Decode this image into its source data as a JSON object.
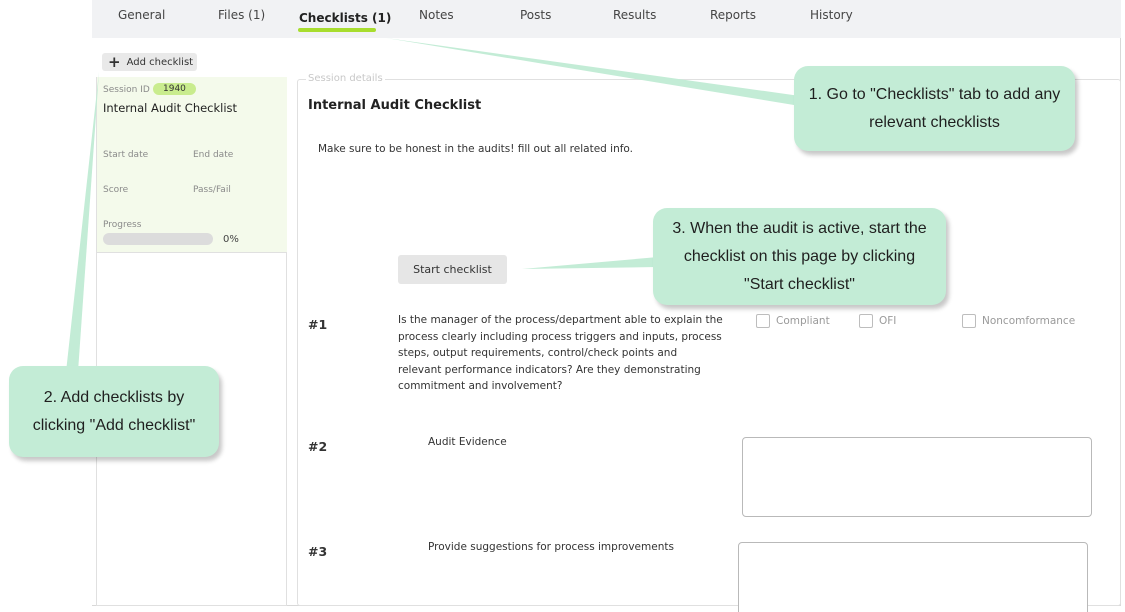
{
  "tabs": [
    {
      "label": "General"
    },
    {
      "label": "Files (1)"
    },
    {
      "label": "Checklists (1)",
      "active": true
    },
    {
      "label": "Notes"
    },
    {
      "label": "Posts"
    },
    {
      "label": "Results"
    },
    {
      "label": "Reports"
    },
    {
      "label": "History"
    }
  ],
  "toolbar": {
    "add_checklist_label": "Add checklist"
  },
  "session": {
    "id_label": "Session ID",
    "id_value": "1940",
    "name": "Internal Audit Checklist",
    "start_date_label": "Start date",
    "end_date_label": "End date",
    "score_label": "Score",
    "pass_fail_label": "Pass/Fail",
    "progress_label": "Progress",
    "progress_value": 0,
    "progress_text": "0%"
  },
  "details": {
    "legend": "Session details",
    "title": "Internal Audit Checklist",
    "description": "Make sure to be honest in the audits! fill out all related info.",
    "start_button": "Start checklist",
    "questions": [
      {
        "number": "#1",
        "text": "Is the manager of the process/department able to explain the process clearly including process triggers and inputs, process steps, output requirements, control/check points and relevant performance indicators? Are they demonstrating commitment and involvement?"
      },
      {
        "number": "#2",
        "label": "Audit Evidence"
      },
      {
        "number": "#3",
        "label": "Provide suggestions for process improvements"
      }
    ],
    "options": [
      "Compliant",
      "OFI",
      "Noncomformance"
    ]
  },
  "callouts": {
    "c1": "1. Go to \"Checklists\" tab to add any relevant checklists",
    "c2": "2. Add checklists by clicking \"Add checklist\"",
    "c3": "3. When the audit is active, start the checklist on this page by clicking \"Start checklist\""
  },
  "colors": {
    "accent": "#a8dd2e",
    "callout_bg": "#c3ecd6",
    "card_bg": "#f4faeb",
    "tabbar_bg": "#f1f2f4"
  }
}
